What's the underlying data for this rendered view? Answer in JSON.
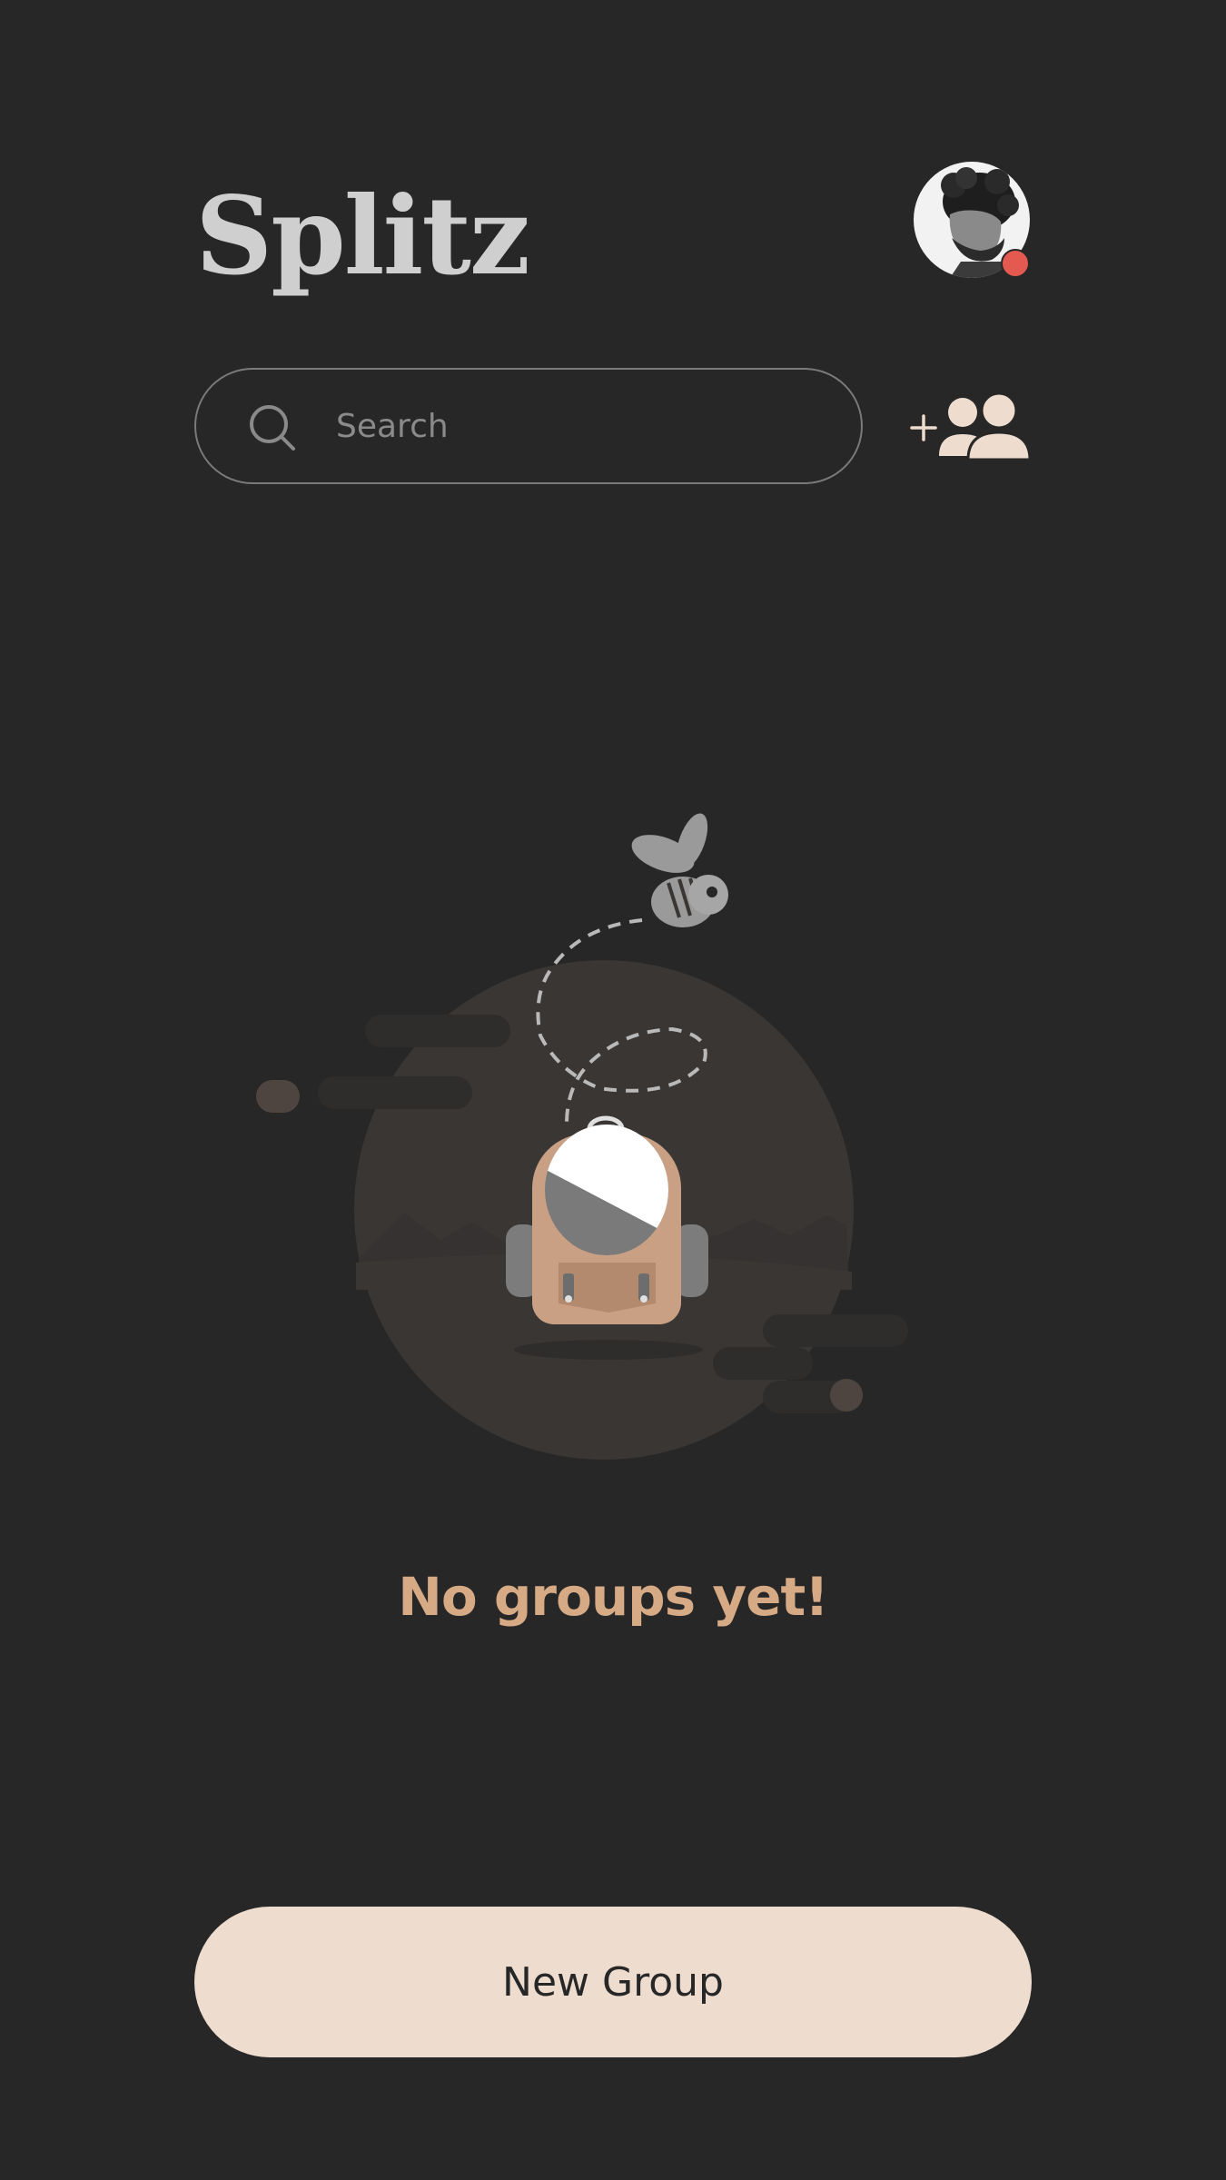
{
  "header": {
    "title": "Splitz",
    "avatar_icon": "user-avatar-photo",
    "status_color": "#e45a50"
  },
  "search": {
    "placeholder": "Search",
    "value": "",
    "icon": "search-icon"
  },
  "add_group": {
    "icon": "add-people-icon"
  },
  "empty_state": {
    "message": "No groups yet!",
    "illustration": "backpack-bee-illustration"
  },
  "actions": {
    "new_group_label": "New Group"
  },
  "colors": {
    "background": "#272727",
    "title": "#cfcfcf",
    "accent": "#d7aa86",
    "button_bg": "#eeddcf",
    "status_dot": "#e45a50"
  }
}
